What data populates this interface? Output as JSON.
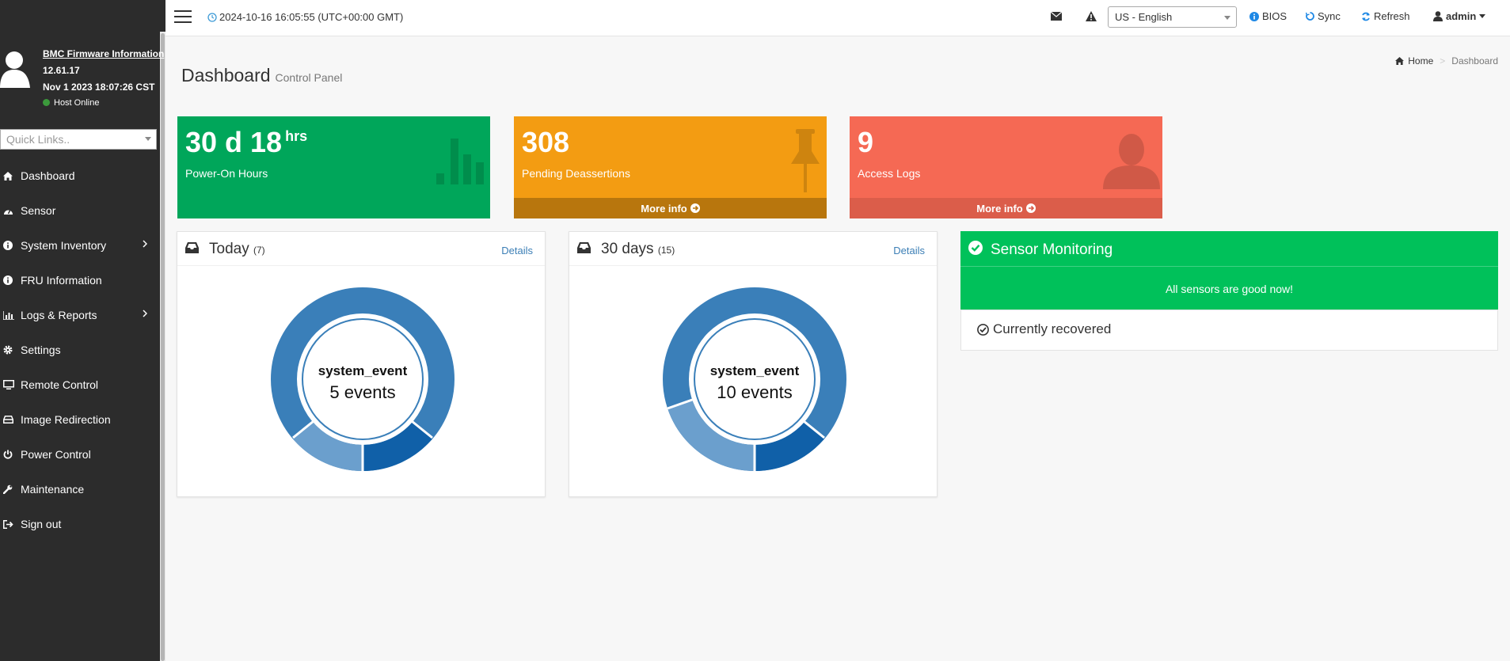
{
  "sidebar": {
    "firmware_link": "BMC Firmware Information",
    "firmware_version": "12.61.17",
    "firmware_date": "Nov 1 2023 18:07:26 CST",
    "host_status": "Host Online",
    "quick_links_placeholder": "Quick Links..",
    "items": [
      {
        "label": "Dashboard",
        "icon": "home-icon"
      },
      {
        "label": "Sensor",
        "icon": "gauge-icon"
      },
      {
        "label": "System Inventory",
        "icon": "info-circle-icon",
        "has_submenu": true
      },
      {
        "label": "FRU Information",
        "icon": "info-circle-icon"
      },
      {
        "label": "Logs & Reports",
        "icon": "bar-chart-icon",
        "has_submenu": true
      },
      {
        "label": "Settings",
        "icon": "gear-icon"
      },
      {
        "label": "Remote Control",
        "icon": "monitor-icon"
      },
      {
        "label": "Image Redirection",
        "icon": "hdd-icon"
      },
      {
        "label": "Power Control",
        "icon": "power-icon"
      },
      {
        "label": "Maintenance",
        "icon": "wrench-icon"
      },
      {
        "label": "Sign out",
        "icon": "sign-out-icon"
      }
    ]
  },
  "header": {
    "datetime": "2024-10-16 16:05:55 (UTC+00:00 GMT)",
    "language": "US - English",
    "bios_label": "BIOS",
    "sync_label": "Sync",
    "refresh_label": "Refresh",
    "user_label": "admin"
  },
  "page": {
    "title": "Dashboard",
    "subtitle": "Control Panel",
    "breadcrumb_home": "Home",
    "breadcrumb_current": "Dashboard"
  },
  "info_boxes": [
    {
      "value": "30 d 18",
      "unit": "hrs",
      "label": "Power-On Hours",
      "color": "#00a65a"
    },
    {
      "value": "308",
      "label": "Pending Deassertions",
      "more": "More info",
      "color": "#f39c12"
    },
    {
      "value": "9",
      "label": "Access Logs",
      "more": "More info",
      "color": "#f56954"
    }
  ],
  "panels": [
    {
      "title": "Today",
      "count": "7",
      "details": "Details",
      "center_name": "system_event",
      "center_value": "5 events"
    },
    {
      "title": "30 days",
      "count": "15",
      "details": "Details",
      "center_name": "system_event",
      "center_value": "10 events"
    }
  ],
  "sensor": {
    "title": "Sensor Monitoring",
    "message": "All sensors are good now!",
    "recovered": "Currently recovered",
    "color": "#00c15a"
  }
}
